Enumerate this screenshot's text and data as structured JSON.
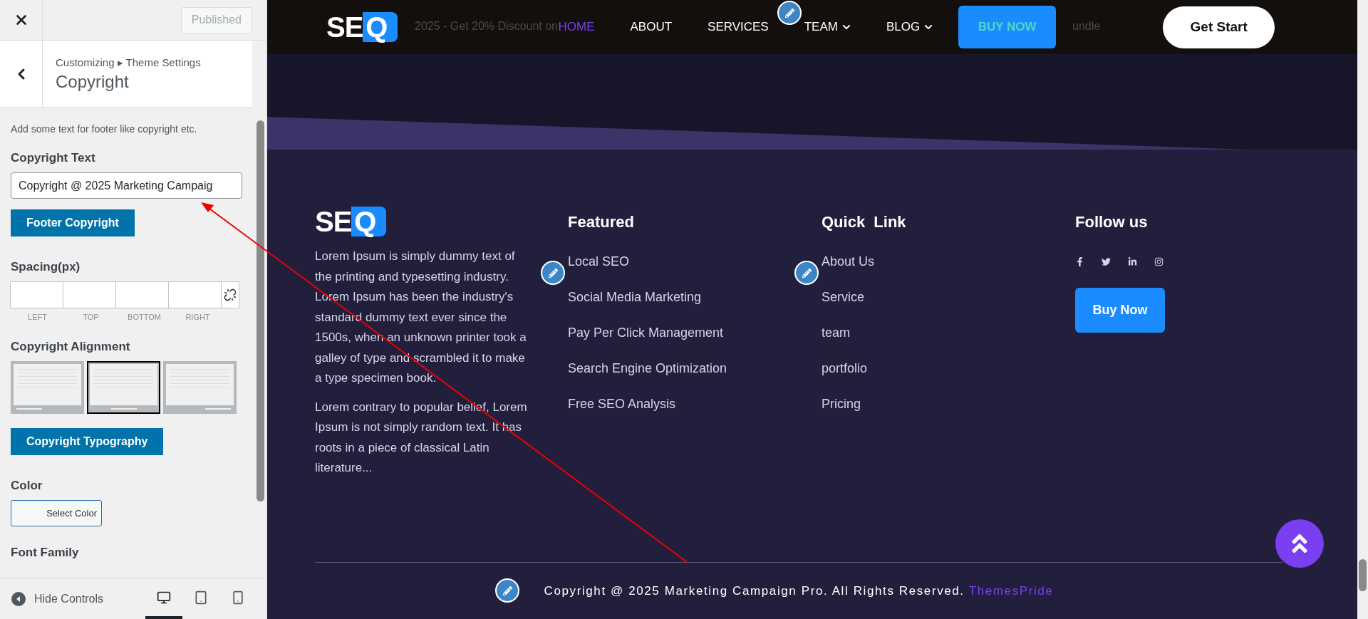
{
  "customizer": {
    "publish_button": "Published",
    "breadcrumb": [
      "Customizing",
      "▸",
      "Theme Settings"
    ],
    "section_title": "Copyright",
    "description": "Add some text for footer like copyright etc.",
    "copyright_text": {
      "label": "Copyright Text",
      "value": "Copyright @ 2025 Marketing Campaig"
    },
    "footer_copyright_button": "Footer Copyright",
    "spacing": {
      "label": "Spacing(px)",
      "sides": [
        "LEFT",
        "TOP",
        "BOTTOM",
        "RIGHT"
      ]
    },
    "alignment": {
      "label": "Copyright Alignment",
      "options": [
        {
          "kind": "left",
          "selected": false
        },
        {
          "kind": "center",
          "selected": true
        },
        {
          "kind": "right",
          "selected": false
        }
      ]
    },
    "typography_button": "Copyright Typography",
    "color": {
      "label": "Color",
      "button": "Select Color"
    },
    "font_family_label": "Font Family",
    "hide_controls": "Hide Controls",
    "devices": [
      {
        "kind": "desktop",
        "selected": true
      },
      {
        "kind": "tablet",
        "selected": false
      },
      {
        "kind": "mobile",
        "selected": false
      }
    ]
  },
  "preview": {
    "promo": {
      "text": "2025 - Get 20% Discount on",
      "bundle_end": "undle"
    },
    "logo": {
      "letters": "SE",
      "mark": "Q"
    },
    "nav": {
      "items": [
        {
          "label": "HOME",
          "selected": true,
          "dropdown": false
        },
        {
          "label": "ABOUT",
          "selected": false,
          "dropdown": false
        },
        {
          "label": "SERVICES",
          "selected": false,
          "dropdown": false
        },
        {
          "label": "TEAM",
          "selected": false,
          "dropdown": true
        },
        {
          "label": "BLOG",
          "selected": false,
          "dropdown": true
        }
      ],
      "buy_button": "BUY NOW",
      "start_button": "Get Start"
    },
    "footer": {
      "logo": {
        "letters": "SE",
        "mark": "Q"
      },
      "about": [
        "Lorem Ipsum is simply dummy text of the printing and typesetting industry. Lorem Ipsum has been the industry's standard dummy text ever since the 1500s, when an unknown printer took a galley of type and scrambled it to make a type specimen book.",
        "Lorem contrary to popular belief, Lorem Ipsum is not simply random text. It has roots in a piece of classical Latin literature..."
      ],
      "featured": {
        "title": "Featured",
        "links": [
          "Local SEO",
          "Social Media Marketing",
          "Pay Per Click Management",
          "Search Engine Optimization",
          "Free SEO Analysis"
        ]
      },
      "quick": {
        "title": "Quick  Link",
        "links": [
          "About Us",
          "Service",
          "team",
          "portfolio",
          "Pricing"
        ]
      },
      "follow": {
        "title": "Follow us",
        "button": "Buy Now"
      },
      "copyright": "Copyright @ 2025 Marketing Campaign Pro. All Rights Reserved.",
      "credit": "ThemesPride"
    }
  }
}
